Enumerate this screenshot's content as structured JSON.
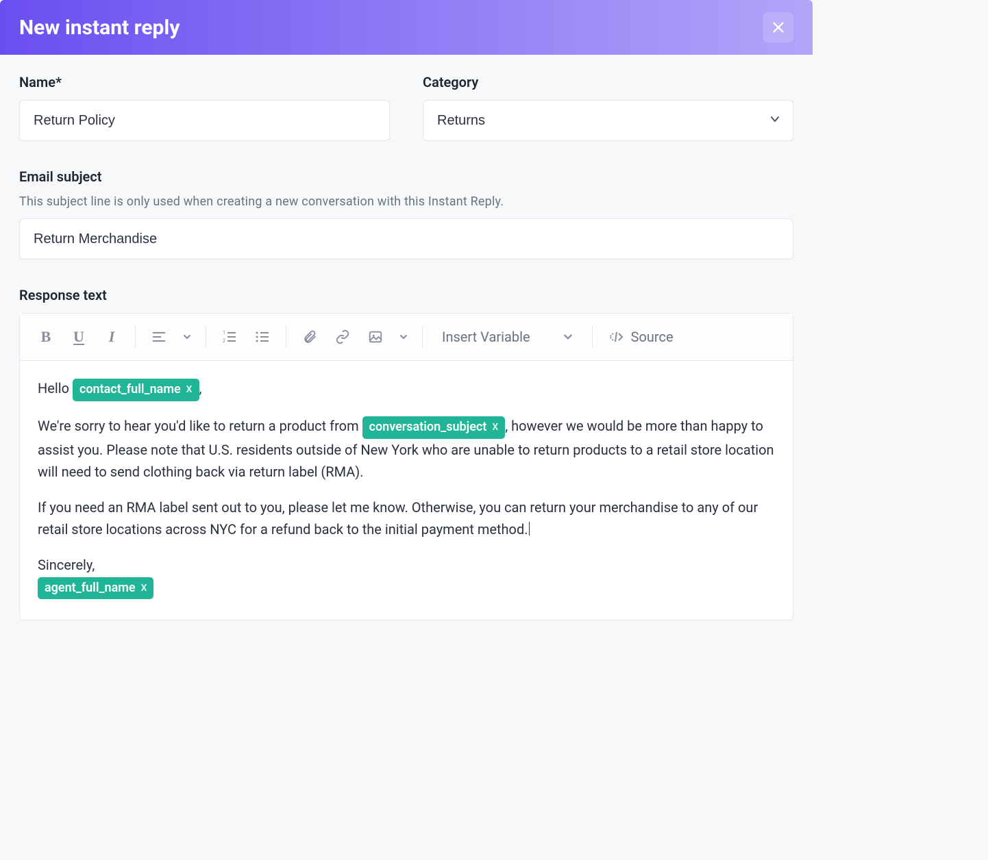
{
  "header": {
    "title": "New instant reply"
  },
  "fields": {
    "name_label": "Name*",
    "name_value": "Return Policy",
    "category_label": "Category",
    "category_value": "Returns",
    "email_subject_label": "Email subject",
    "email_subject_help": "This subject line is only used when creating a new conversation with this Instant Reply.",
    "email_subject_value": "Return Merchandise",
    "response_label": "Response text"
  },
  "toolbar": {
    "insert_variable": "Insert Variable",
    "source": "Source"
  },
  "body": {
    "greeting_prefix": "Hello ",
    "greeting_suffix": ",",
    "chip_contact": "contact_full_name",
    "para1_before": "We're sorry to hear you'd like to return a product from ",
    "chip_subject": "conversation_subject",
    "para1_after": ", however we would be more than happy to assist you. Please note that U.S. residents outside of New York who are unable to return products to a retail store location will need to send clothing back via return label (RMA).",
    "para2": "If you need an RMA label sent out to you, please let me know. Otherwise, you can return your merchandise to any of our retail store locations across NYC for a refund back to the initial payment method.",
    "signoff": "Sincerely,",
    "chip_agent": "agent_full_name",
    "chip_remove": "X"
  }
}
